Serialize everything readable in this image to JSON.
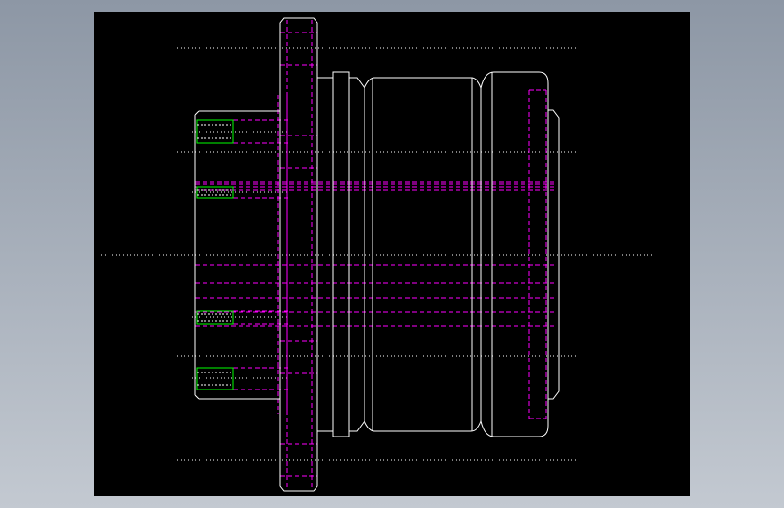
{
  "canvas": {
    "background_gradient_top": "#8d97a5",
    "background_gradient_bottom": "#c3c9d1",
    "viewport_color": "#000000"
  },
  "colors": {
    "outline": "#ffffff",
    "hidden_line": "#ff00ff",
    "thread": "#00ff00",
    "center_line": "#ffffff"
  },
  "drawing": {
    "subject": "flanged-cylindrical-part",
    "view": "side-section",
    "visible_text": []
  }
}
